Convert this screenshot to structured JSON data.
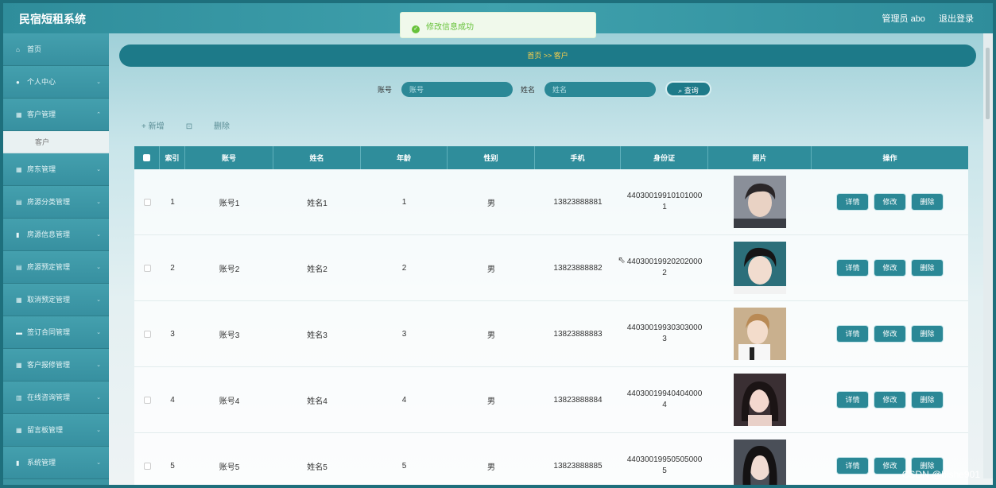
{
  "app": {
    "title": "民宿短租系统"
  },
  "topbar": {
    "user": "管理员 abo",
    "logout": "退出登录"
  },
  "toast": {
    "message": "修改信息成功"
  },
  "sidebar": {
    "items": [
      {
        "label": "首页",
        "icon": "home-icon"
      },
      {
        "label": "个人中心",
        "icon": "user-icon"
      },
      {
        "label": "客户管理",
        "icon": "grid-icon",
        "children": [
          "客户"
        ]
      },
      {
        "label": "房东管理",
        "icon": "grid-icon"
      },
      {
        "label": "房源分类管理",
        "icon": "doc-icon"
      },
      {
        "label": "房源信息管理",
        "icon": "lock-icon"
      },
      {
        "label": "房源预定管理",
        "icon": "doc-icon"
      },
      {
        "label": "取消预定管理",
        "icon": "grid-icon"
      },
      {
        "label": "签订合同管理",
        "icon": "card-icon"
      },
      {
        "label": "客户报修管理",
        "icon": "grid-icon"
      },
      {
        "label": "在线咨询管理",
        "icon": "chart-icon"
      },
      {
        "label": "留言板管理",
        "icon": "grid-icon"
      },
      {
        "label": "系统管理",
        "icon": "lock-icon"
      }
    ]
  },
  "breadcrumb": "首页 >> 客户",
  "search": {
    "account_label": "账号",
    "account_placeholder": "账号",
    "name_label": "姓名",
    "name_placeholder": "姓名",
    "button": "查询"
  },
  "actions": {
    "add": "+ 新增",
    "delete": "删除"
  },
  "table": {
    "headers": [
      "索引",
      "账号",
      "姓名",
      "年龄",
      "性别",
      "手机",
      "身份证",
      "照片",
      "操作"
    ],
    "rows": [
      {
        "index": "1",
        "account": "账号1",
        "name": "姓名1",
        "age": "1",
        "gender": "男",
        "phone": "13823888881",
        "idcard": "440300199101010001"
      },
      {
        "index": "2",
        "account": "账号2",
        "name": "姓名2",
        "age": "2",
        "gender": "男",
        "phone": "13823888882",
        "idcard": "440300199202020002"
      },
      {
        "index": "3",
        "account": "账号3",
        "name": "姓名3",
        "age": "3",
        "gender": "男",
        "phone": "13823888883",
        "idcard": "440300199303030003"
      },
      {
        "index": "4",
        "account": "账号4",
        "name": "姓名4",
        "age": "4",
        "gender": "男",
        "phone": "13823888884",
        "idcard": "440300199404040004"
      },
      {
        "index": "5",
        "account": "账号5",
        "name": "姓名5",
        "age": "5",
        "gender": "男",
        "phone": "13823888885",
        "idcard": "440300199505050005"
      }
    ],
    "row_buttons": {
      "detail": "详情",
      "edit": "修改",
      "delete": "删除"
    }
  },
  "watermark": "CSDN @bishe901",
  "colors": {
    "primary": "#2f8d9b",
    "dark": "#1d7a89",
    "accent": "#ffd24a",
    "success": "#67c23a"
  }
}
